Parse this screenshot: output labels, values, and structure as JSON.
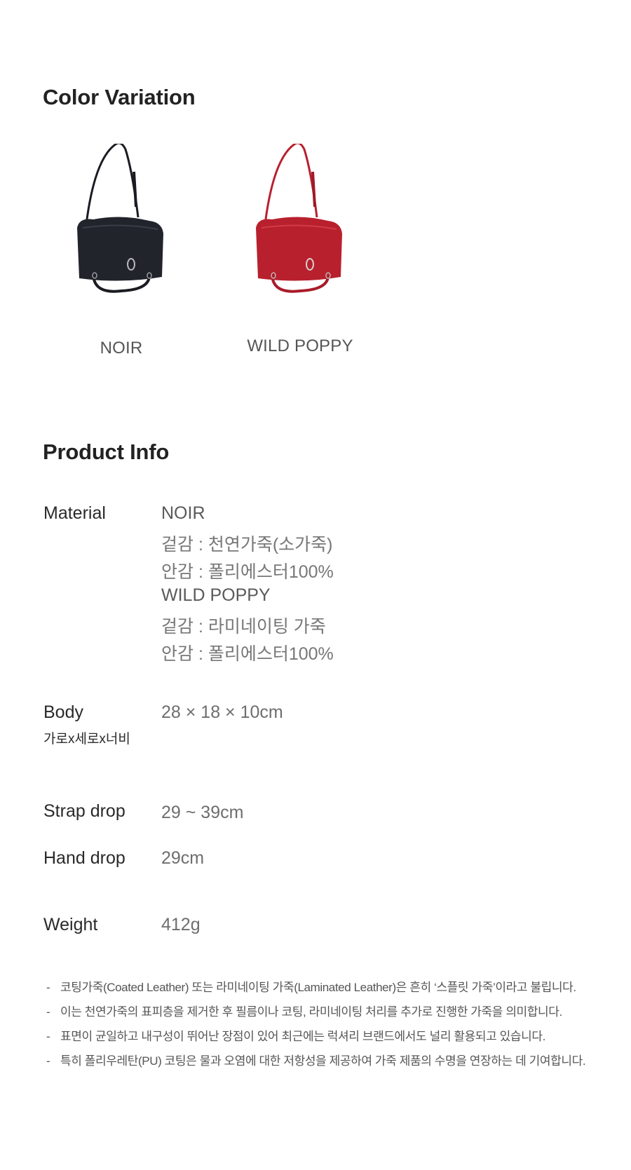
{
  "color_section": {
    "title": "Color Variation",
    "variants": [
      {
        "name": "NOIR",
        "color": "#22242c"
      },
      {
        "name": "WILD POPPY",
        "color": "#b8202e"
      }
    ]
  },
  "info_section": {
    "title": "Product Info",
    "material": {
      "label": "Material",
      "lines": [
        "NOIR",
        "겉감 : 천연가죽(소가죽)",
        "안감 : 폴리에스터100%",
        "WILD POPPY",
        "겉감 : 라미네이팅 가죽",
        "안감 : 폴리에스터100%"
      ]
    },
    "body": {
      "label": "Body",
      "sublabel": "가로x세로x너비",
      "value": "28 × 18 × 10cm"
    },
    "strap_drop": {
      "label": "Strap drop",
      "value": "29 ~ 39cm"
    },
    "hand_drop": {
      "label": "Hand drop",
      "value": "29cm"
    },
    "weight": {
      "label": "Weight",
      "value": "412g"
    }
  },
  "notes": [
    "코팅가죽(Coated Leather) 또는 라미네이팅 가죽(Laminated Leather)은 흔히 ‘스플릿 가죽’이라고 불립니다.",
    "이는 천연가죽의 표피층을 제거한 후 필름이나 코팅, 라미네이팅 처리를 추가로 진행한 가죽을 의미합니다.",
    "표면이 균일하고 내구성이 뛰어난 장점이 있어 최근에는 럭셔리 브랜드에서도 널리 활용되고 있습니다.",
    "특히 폴리우레탄(PU) 코팅은 물과 오염에 대한 저항성을 제공하여 가죽 제품의 수명을 연장하는 데 기여합니다."
  ],
  "note_bullet": "-"
}
